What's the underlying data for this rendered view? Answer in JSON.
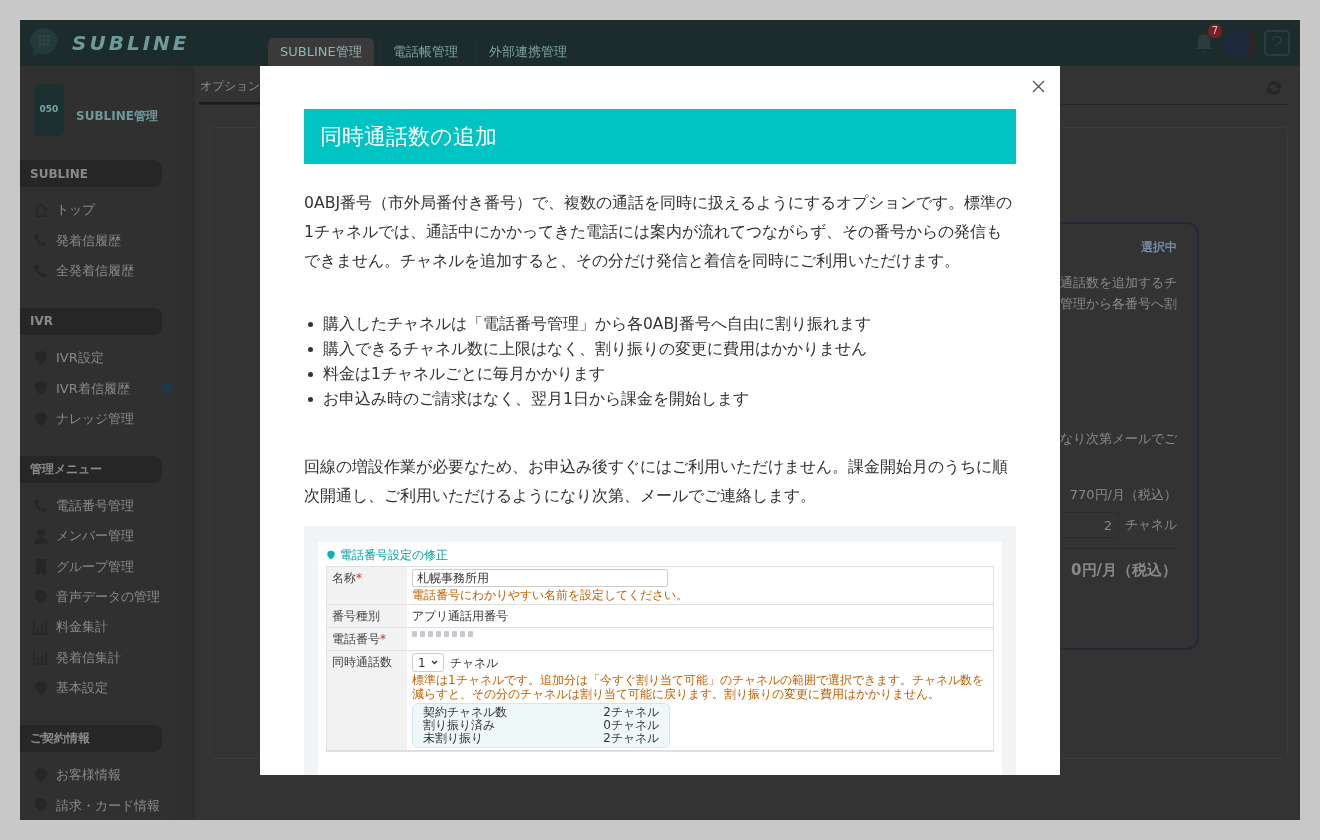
{
  "header": {
    "logo": "SUBLINE",
    "tabs": [
      {
        "label": "SUBLINE管理",
        "selected": true
      },
      {
        "label": "電話帳管理",
        "selected": false
      },
      {
        "label": "外部連携管理",
        "selected": false
      }
    ],
    "notification_count": "7"
  },
  "sidebar": {
    "title": "SUBLINE管理",
    "phone_label": "050",
    "sections": [
      {
        "heading": "SUBLINE",
        "items": [
          {
            "label": "トップ"
          },
          {
            "label": "発着信履歴"
          },
          {
            "label": "全発着信履歴"
          }
        ]
      },
      {
        "heading": "IVR",
        "items": [
          {
            "label": "IVR設定"
          },
          {
            "label": "IVR着信履歴"
          },
          {
            "label": "ナレッジ管理"
          }
        ]
      },
      {
        "heading": "管理メニュー",
        "items": [
          {
            "label": "電話番号管理"
          },
          {
            "label": "メンバー管理"
          },
          {
            "label": "グループ管理"
          },
          {
            "label": "音声データの管理"
          },
          {
            "label": "料金集計"
          },
          {
            "label": "発着信集計"
          },
          {
            "label": "基本設定"
          }
        ]
      },
      {
        "heading": "ご契約情報",
        "items": [
          {
            "label": "お客様情報"
          },
          {
            "label": "請求・カード情報"
          }
        ]
      }
    ]
  },
  "main": {
    "tabs": [
      {
        "label": "オプション",
        "selected": true
      }
    ],
    "card": {
      "badge": "選択中",
      "lines": [
        "通話数を追加するチ",
        "管理から各番号へ割"
      ],
      "note": "なり次第メールでご",
      "price": "770円/月（税込）",
      "quantity": "2",
      "unit": "チャネル",
      "total": "0円/月（税込）"
    }
  },
  "modal": {
    "title": "同時通話数の追加",
    "intro": "0ABJ番号（市外局番付き番号）で、複数の通話を同時に扱えるようにするオプションです。標準の1チャネルでは、通話中にかかってきた電話には案内が流れてつながらず、その番号からの発信もできません。チャネルを追加すると、その分だけ発信と着信を同時にご利用いただけます。",
    "bullets": [
      "購入したチャネルは「電話番号管理」から各0ABJ番号へ自由に割り振れます",
      "購入できるチャネル数に上限はなく、割り振りの変更に費用はかかりません",
      "料金は1チャネルごとに毎月かかります",
      "お申込み時のご請求はなく、翌月1日から課金を開始します"
    ],
    "notice": "回線の増設作業が必要なため、お申込み後すぐにはご利用いただけません。課金開始月のうちに順次開通し、ご利用いただけるようになり次第、メールでご連絡します。",
    "example": {
      "title": "電話番号設定の修正",
      "rows": [
        {
          "label": "名称",
          "required_mark": "*",
          "kind": "input",
          "value": "札幌事務所用",
          "hint": "電話番号にわかりやすい名前を設定してください。"
        },
        {
          "label": "番号種別",
          "kind": "text",
          "value": "アプリ通話用番号"
        },
        {
          "label": "電話番号",
          "required_mark": "*",
          "kind": "blurred"
        },
        {
          "label": "同時通話数",
          "kind": "select",
          "value": "1",
          "unit": "チャネル",
          "hint": "標準は1チャネルです。追加分は「今すぐ割り当て可能」のチャネルの範囲で選択できます。チャネル数を減らすと、その分のチャネルは割り当て可能に戻ります。割り振りの変更に費用はかかりません。",
          "summary": [
            {
              "label": "契約チャネル数",
              "value": "2チャネル"
            },
            {
              "label": "割り振り済み",
              "value": "0チャネル"
            },
            {
              "label": "未割り振り",
              "value": "2チャネル"
            }
          ]
        }
      ]
    }
  }
}
